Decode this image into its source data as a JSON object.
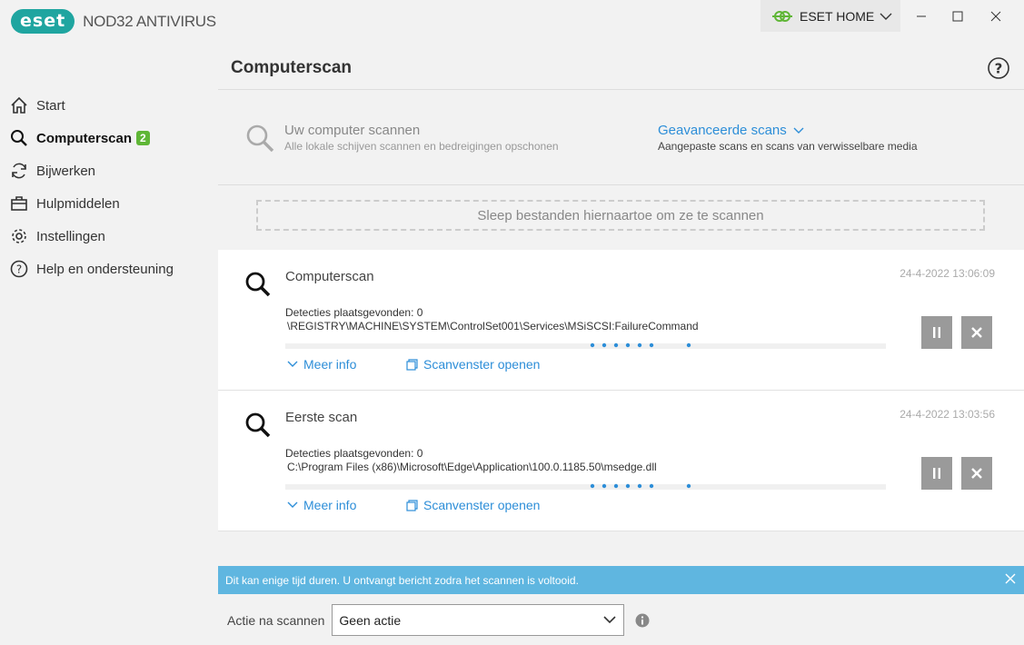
{
  "app": {
    "logo_text": "eset",
    "product_name": "NOD32 ANTIVIRUS",
    "home_button": "ESET HOME",
    "accent_color": "#1fa5a0"
  },
  "sidebar": {
    "items": [
      {
        "label": "Start",
        "icon": "home-icon"
      },
      {
        "label": "Computerscan",
        "icon": "search-icon",
        "badge": "2"
      },
      {
        "label": "Bijwerken",
        "icon": "refresh-icon"
      },
      {
        "label": "Hulpmiddelen",
        "icon": "briefcase-icon"
      },
      {
        "label": "Instellingen",
        "icon": "gear-icon"
      },
      {
        "label": "Help en ondersteuning",
        "icon": "help-icon"
      }
    ]
  },
  "main": {
    "title": "Computerscan",
    "scan_option_1": {
      "title": "Uw computer scannen",
      "subtitle": "Alle lokale schijven scannen en bedreigingen opschonen"
    },
    "scan_option_2": {
      "title": "Geavanceerde scans",
      "subtitle": "Aangepaste scans en scans van verwisselbare media"
    },
    "dropzone": "Sleep bestanden hiernaartoe om ze te scannen",
    "scans": [
      {
        "title": "Computerscan",
        "date": "24-4-2022 13:06:09",
        "detections": "Detecties plaatsgevonden: 0",
        "path": "\\REGISTRY\\MACHINE\\SYSTEM\\ControlSet001\\Services\\MSiSCSI:FailureCommand",
        "more_info": "Meer info",
        "open_window": "Scanvenster openen"
      },
      {
        "title": "Eerste scan",
        "date": "24-4-2022 13:03:56",
        "detections": "Detecties plaatsgevonden: 0",
        "path": "C:\\Program Files (x86)\\Microsoft\\Edge\\Application\\100.0.1185.50\\msedge.dll",
        "more_info": "Meer info",
        "open_window": "Scanvenster openen"
      }
    ],
    "info_message": "Dit kan enige tijd duren. U ontvangt bericht zodra het scannen is voltooid.",
    "action_label": "Actie na scannen",
    "action_value": "Geen actie"
  }
}
